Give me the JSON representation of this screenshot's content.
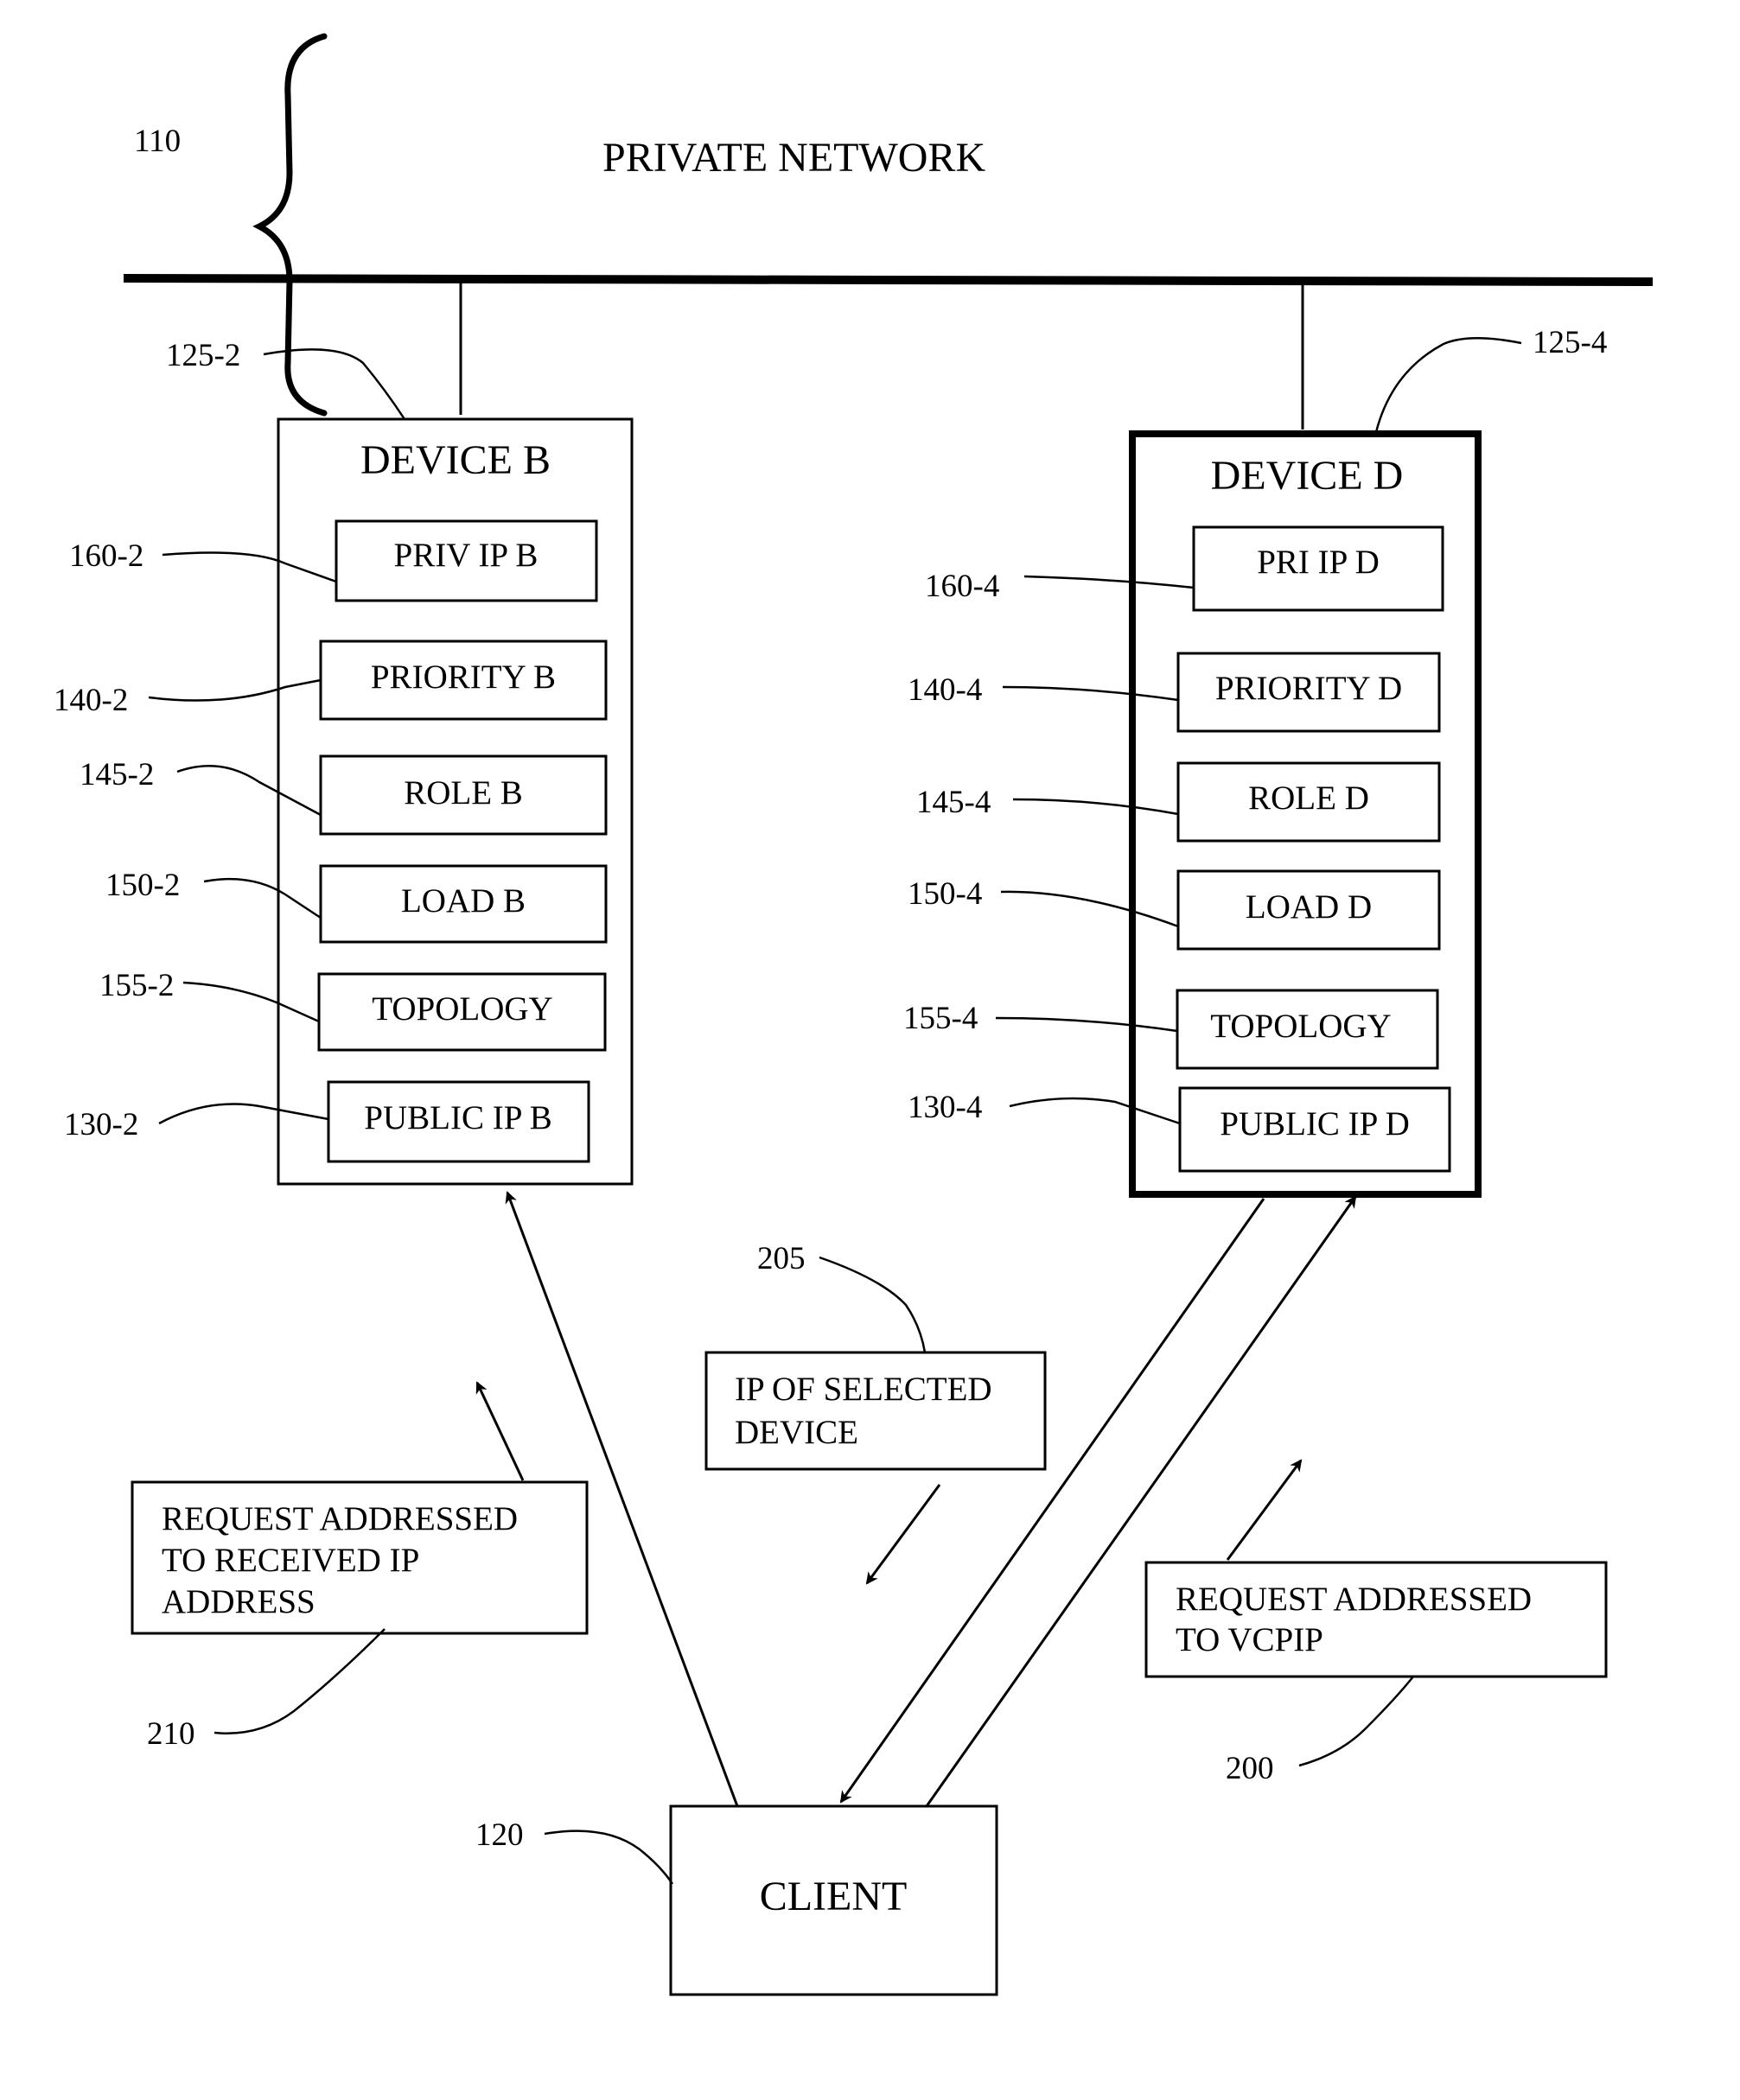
{
  "network": {
    "ref": "110",
    "label": "PRIVATE NETWORK"
  },
  "device_b": {
    "ref": "125-2",
    "title": "DEVICE B",
    "fields": [
      {
        "ref": "160-2",
        "label": "PRIV IP B"
      },
      {
        "ref": "140-2",
        "label": "PRIORITY B"
      },
      {
        "ref": "145-2",
        "label": "ROLE B"
      },
      {
        "ref": "150-2",
        "label": "LOAD B"
      },
      {
        "ref": "155-2",
        "label": "TOPOLOGY"
      },
      {
        "ref": "130-2",
        "label": "PUBLIC IP B"
      }
    ]
  },
  "device_d": {
    "ref": "125-4",
    "title": "DEVICE D",
    "fields": [
      {
        "ref": "160-4",
        "label": "PRI IP D"
      },
      {
        "ref": "140-4",
        "label": "PRIORITY D"
      },
      {
        "ref": "145-4",
        "label": "ROLE D"
      },
      {
        "ref": "150-4",
        "label": "LOAD D"
      },
      {
        "ref": "155-4",
        "label": "TOPOLOGY"
      },
      {
        "ref": "130-4",
        "label": "PUBLIC IP D"
      }
    ]
  },
  "messages": {
    "m205": {
      "ref": "205",
      "lines": [
        "IP OF SELECTED",
        "DEVICE"
      ]
    },
    "m210": {
      "ref": "210",
      "lines": [
        "REQUEST ADDRESSED",
        "TO RECEIVED IP",
        "ADDRESS"
      ]
    },
    "m200": {
      "ref": "200",
      "lines": [
        "REQUEST ADDRESSED",
        "TO VCPIP"
      ]
    }
  },
  "client": {
    "ref": "120",
    "label": "CLIENT"
  }
}
